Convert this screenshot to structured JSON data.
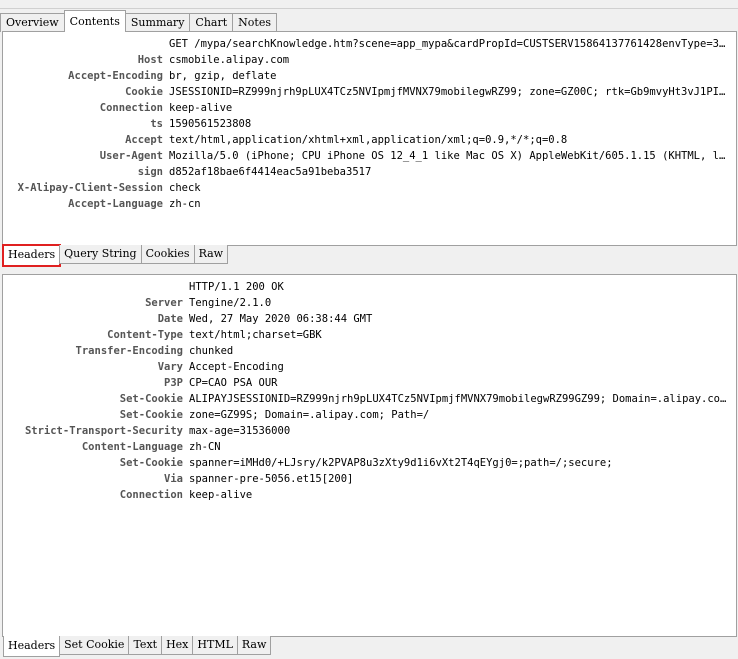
{
  "main_tabs": [
    "Overview",
    "Contents",
    "Summary",
    "Chart",
    "Notes"
  ],
  "request": {
    "rows": [
      {
        "key": "",
        "value": "GET /mypa/searchKnowledge.htm?scene=app_mypa&cardPropId=CUSTSERV15864137761428envType=3&b..."
      },
      {
        "key": "Host",
        "value": "csmobile.alipay.com"
      },
      {
        "key": "Accept-Encoding",
        "value": "br, gzip, deflate"
      },
      {
        "key": "Cookie",
        "value": "JSESSIONID=RZ999njrh9pLUX4TCz5NVIpmjfMVNX79mobilegwRZ99; zone=GZ00C; rtk=Gb9mvyHt3vJ1PIh0..."
      },
      {
        "key": "Connection",
        "value": "keep-alive"
      },
      {
        "key": "ts",
        "value": "1590561523808"
      },
      {
        "key": "Accept",
        "value": "text/html,application/xhtml+xml,application/xml;q=0.9,*/*;q=0.8"
      },
      {
        "key": "User-Agent",
        "value": "Mozilla/5.0 (iPhone; CPU iPhone OS 12_4_1 like Mac OS X) AppleWebKit/605.1.15 (KHTML, lik..."
      },
      {
        "key": "sign",
        "value": "d852af18bae6f4414eac5a91beba3517"
      },
      {
        "key": "X-Alipay-Client-Session",
        "value": "check"
      },
      {
        "key": "Accept-Language",
        "value": "zh-cn"
      }
    ]
  },
  "request_subtabs": [
    "Headers",
    "Query String",
    "Cookies",
    "Raw"
  ],
  "response": {
    "rows": [
      {
        "key": "",
        "value": "HTTP/1.1 200 OK"
      },
      {
        "key": "Server",
        "value": "Tengine/2.1.0"
      },
      {
        "key": "Date",
        "value": "Wed, 27 May 2020 06:38:44 GMT"
      },
      {
        "key": "Content-Type",
        "value": "text/html;charset=GBK"
      },
      {
        "key": "Transfer-Encoding",
        "value": "chunked"
      },
      {
        "key": "Vary",
        "value": "Accept-Encoding"
      },
      {
        "key": "P3P",
        "value": "CP=CAO PSA OUR"
      },
      {
        "key": "Set-Cookie",
        "value": "ALIPAYJSESSIONID=RZ999njrh9pLUX4TCz5NVIpmjfMVNX79mobilegwRZ99GZ99; Domain=.alipay.com; ..."
      },
      {
        "key": "Set-Cookie",
        "value": "zone=GZ99S; Domain=.alipay.com; Path=/"
      },
      {
        "key": "Strict-Transport-Security",
        "value": "max-age=31536000"
      },
      {
        "key": "Content-Language",
        "value": "zh-CN"
      },
      {
        "key": "Set-Cookie",
        "value": "spanner=iMHd0/+LJsry/k2PVAP8u3zXty9d1i6vXt2T4qEYgj0=;path=/;secure;"
      },
      {
        "key": "Via",
        "value": "spanner-pre-5056.et15[200]"
      },
      {
        "key": "Connection",
        "value": "keep-alive"
      }
    ]
  },
  "response_subtabs": [
    "Headers",
    "Set Cookie",
    "Text",
    "Hex",
    "HTML",
    "Raw"
  ]
}
